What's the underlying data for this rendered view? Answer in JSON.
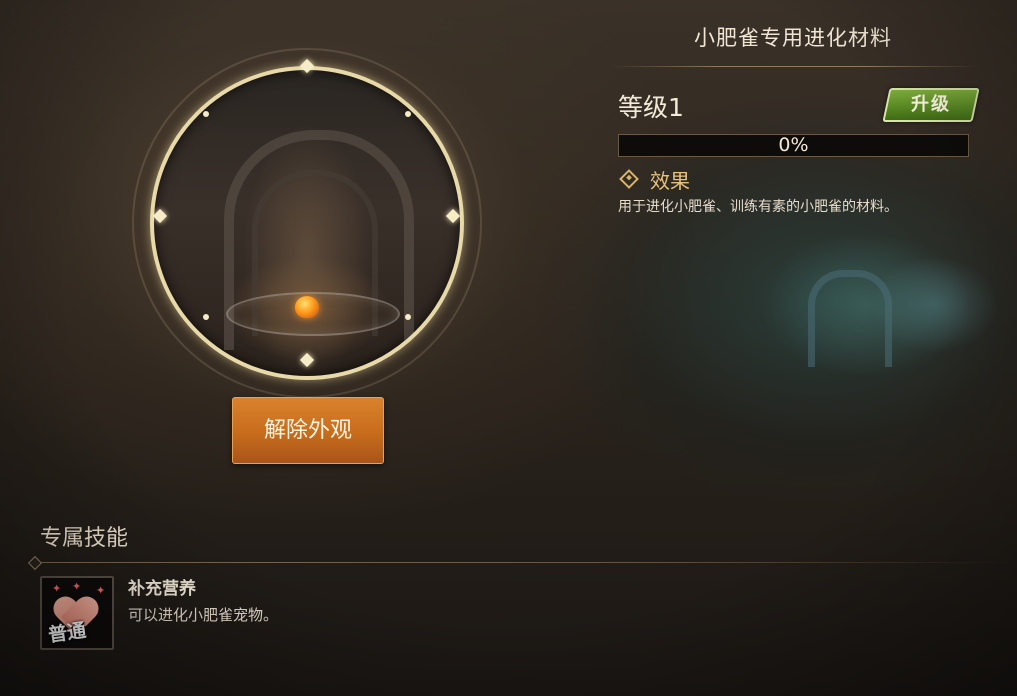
{
  "panel": {
    "title": "小肥雀专用进化材料",
    "level_label": "等级1",
    "upgrade_button": "升级",
    "progress": {
      "value": 0,
      "text": "0%"
    },
    "effect": {
      "label": "效果",
      "description": "用于进化小肥雀、训练有素的小肥雀的材料。"
    }
  },
  "portrait": {
    "remove_appearance_button": "解除外观"
  },
  "skill_section": {
    "title": "专属技能",
    "skills": [
      {
        "icon": "heart-icon",
        "badge": "普通",
        "name": "补充营养",
        "description": "可以进化小肥雀宠物。"
      }
    ]
  },
  "colors": {
    "upgrade_button": "#5b8a24",
    "remove_button": "#c76c1c",
    "effect_label": "#e7c17a",
    "ring": "#e8d9a8"
  }
}
